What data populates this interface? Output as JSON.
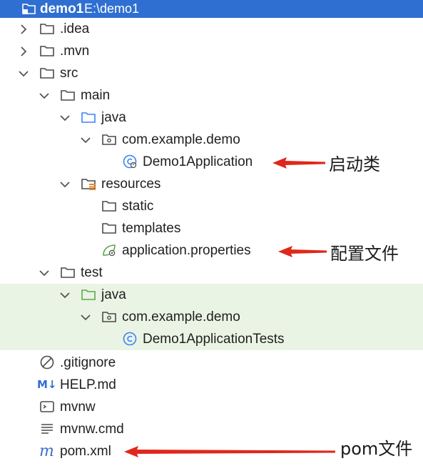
{
  "colors": {
    "selection": "#2f6fd1",
    "test_background": "#eaf4e4",
    "arrow": "#e0271b",
    "folder_stroke": "#4a4a4a",
    "source_folder": "#3b82f6",
    "test_folder": "#5aa84b"
  },
  "root": {
    "name": "demo1",
    "path": "E:\\demo1",
    "icon": "module-folder-icon"
  },
  "tree": [
    {
      "label": ".idea",
      "icon": "folder-icon",
      "expanded": false
    },
    {
      "label": ".mvn",
      "icon": "folder-icon",
      "expanded": false
    },
    {
      "label": "src",
      "icon": "folder-icon",
      "expanded": true
    },
    {
      "label": "main",
      "icon": "folder-icon",
      "expanded": true
    },
    {
      "label": "java",
      "icon": "source-folder-icon",
      "expanded": true
    },
    {
      "label": "com.example.demo",
      "icon": "package-icon",
      "expanded": true
    },
    {
      "label": "Demo1Application",
      "icon": "spring-boot-class-icon"
    },
    {
      "label": "resources",
      "icon": "resources-folder-icon",
      "expanded": true
    },
    {
      "label": "static",
      "icon": "folder-icon"
    },
    {
      "label": "templates",
      "icon": "folder-icon"
    },
    {
      "label": "application.properties",
      "icon": "spring-properties-icon"
    },
    {
      "label": "test",
      "icon": "folder-icon",
      "expanded": true
    },
    {
      "label": "java",
      "icon": "test-source-folder-icon",
      "expanded": true
    },
    {
      "label": "com.example.demo",
      "icon": "package-icon",
      "expanded": true
    },
    {
      "label": "Demo1ApplicationTests",
      "icon": "class-icon"
    },
    {
      "label": ".gitignore",
      "icon": "ignore-file-icon"
    },
    {
      "label": "HELP.md",
      "icon": "markdown-icon"
    },
    {
      "label": "mvnw",
      "icon": "shell-script-icon"
    },
    {
      "label": "mvnw.cmd",
      "icon": "text-file-icon"
    },
    {
      "label": "pom.xml",
      "icon": "maven-icon"
    }
  ],
  "annotations": {
    "startup_class": "启动类",
    "config_file": "配置文件",
    "pom_file": "pom文件"
  },
  "glyphs": {
    "markdown": "M↓",
    "maven": "m"
  }
}
